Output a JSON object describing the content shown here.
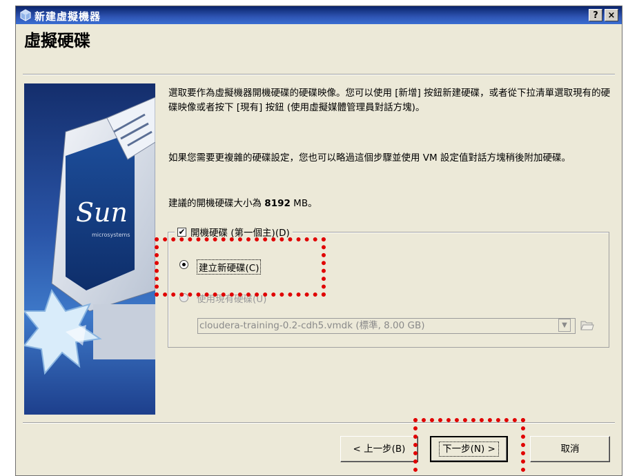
{
  "window": {
    "title": "新建虛擬機器",
    "help_button": "?",
    "close_button": "×"
  },
  "header": {
    "title": "虛擬硬碟"
  },
  "body": {
    "para1": "選取要作為虛擬機器開機硬碟的硬碟映像。您可以使用 [新增] 按鈕新建硬碟，或者從下拉清單選取現有的硬碟映像或者按下 [現有] 按鈕 (使用虛擬媒體管理員對話方塊)。",
    "para2": "如果您需要更複雜的硬碟設定，您也可以略過這個步驟並使用 VM 設定值對話方塊稍後附加硬碟。",
    "para3_prefix": "建議的開機硬碟大小為 ",
    "para3_value": "8192",
    "para3_unit": " MB。"
  },
  "boot_disk": {
    "checkbox_label": "開機硬碟 (第一個主)(D)",
    "checked": true,
    "option_new": "建立新硬碟(C)",
    "option_existing": "使用現有硬碟(U)",
    "selected_option": "new",
    "existing_disk_value": "cloudera-training-0.2-cdh5.vmdk (標準, 8.00 GB)"
  },
  "buttons": {
    "back": "< 上一步(B)",
    "next": "下一步(N) >",
    "cancel": "取消"
  },
  "colors": {
    "titlebar": "#0a246a",
    "dialog_bg": "#ece9d8",
    "highlight": "#e00000"
  },
  "side_image": {
    "brand": "Sun",
    "sub": "microsystems"
  }
}
